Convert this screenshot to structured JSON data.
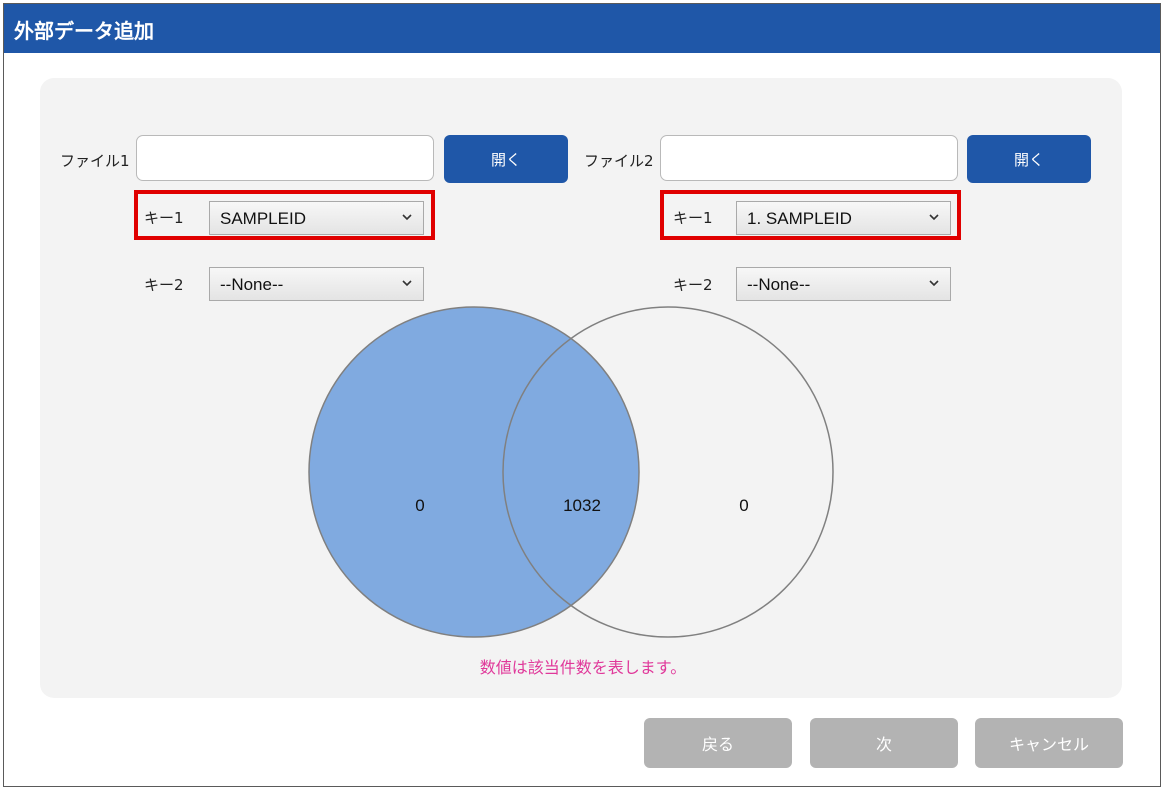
{
  "window": {
    "title": "外部データ追加"
  },
  "file1": {
    "label": "ファイル1",
    "value": "",
    "open_label": "開く"
  },
  "file2": {
    "label": "ファイル2",
    "value": "",
    "open_label": "開く"
  },
  "left_keys": {
    "key1_label": "キー1",
    "key1_value": "SAMPLEID",
    "key2_label": "キー2",
    "key2_value": "--None--"
  },
  "right_keys": {
    "key1_label": "キー1",
    "key1_value": "1. SAMPLEID",
    "key2_label": "キー2",
    "key2_value": "--None--"
  },
  "venn": {
    "left_only": "0",
    "both": "1032",
    "right_only": "0",
    "left_fill": "#80aae0",
    "stroke": "#808080"
  },
  "note": "数値は該当件数を表します。",
  "footer": {
    "back_label": "戻る",
    "next_label": "次",
    "cancel_label": "キャンセル"
  },
  "colors": {
    "accent": "#1f57a8",
    "highlight": "#e00000",
    "note": "#e0389a",
    "disabled_button": "#b3b3b3"
  }
}
